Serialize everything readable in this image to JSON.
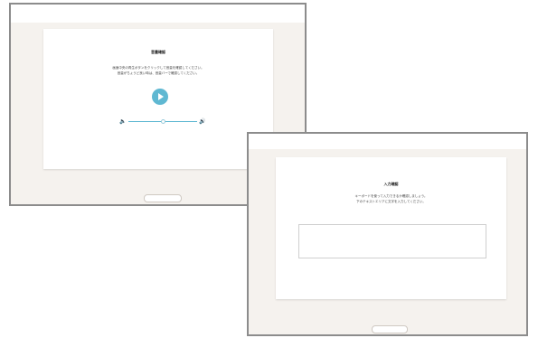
{
  "audio_check": {
    "title": "音量確認",
    "instructions": "画面中央の再生ボタンをクリックして音量を確認してください。\n音量がちょうど良い時は、音量バーで確認してください。",
    "play_button": "play-icon",
    "volume_low_icon": "speaker-low-icon",
    "volume_high_icon": "speaker-high-icon",
    "volume_level": 0.5,
    "accent_color": "#5fb8d2"
  },
  "input_check": {
    "title": "入力確認",
    "instructions": "キーボードを使って入力できるか確認しましょう。\n下のテキストエリアに文字を入力してください。",
    "text_area_value": ""
  },
  "colors": {
    "page_background": "#f5f2ee",
    "frame_border": "#8c8c8c",
    "card_background": "#ffffff"
  }
}
